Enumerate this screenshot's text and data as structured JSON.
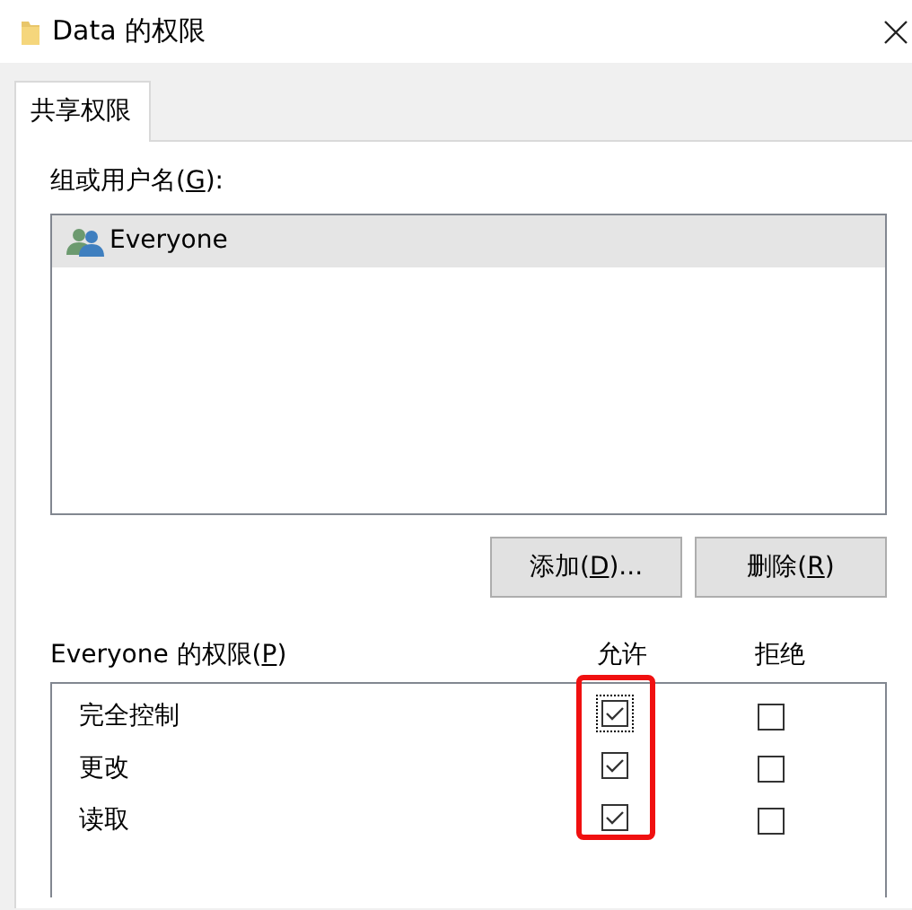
{
  "window": {
    "title": "Data 的权限"
  },
  "tabs": [
    {
      "label": "共享权限",
      "selected": true
    }
  ],
  "groups_label": {
    "text_before": "组或用户名(",
    "access_key": "G",
    "text_after": "):"
  },
  "users": [
    {
      "name": "Everyone",
      "selected": true
    }
  ],
  "buttons": [
    {
      "text_before": "添加(",
      "access_key": "D",
      "text_after": ")..."
    },
    {
      "text_before": "删除(",
      "access_key": "R",
      "text_after": ")"
    }
  ],
  "permissions_label": {
    "text_before": "Everyone 的权限(",
    "access_key": "P",
    "text_after": ")"
  },
  "columns": [
    "允许",
    "拒绝"
  ],
  "permissions": [
    {
      "name": "完全控制",
      "allow": {
        "checked": true,
        "focused": true
      },
      "deny": {
        "checked": false
      }
    },
    {
      "name": "更改",
      "allow": {
        "checked": true
      },
      "deny": {
        "checked": false
      }
    },
    {
      "name": "读取",
      "allow": {
        "checked": true
      },
      "deny": {
        "checked": false
      }
    }
  ],
  "annotation": {
    "allow_column_highlighted": true
  }
}
